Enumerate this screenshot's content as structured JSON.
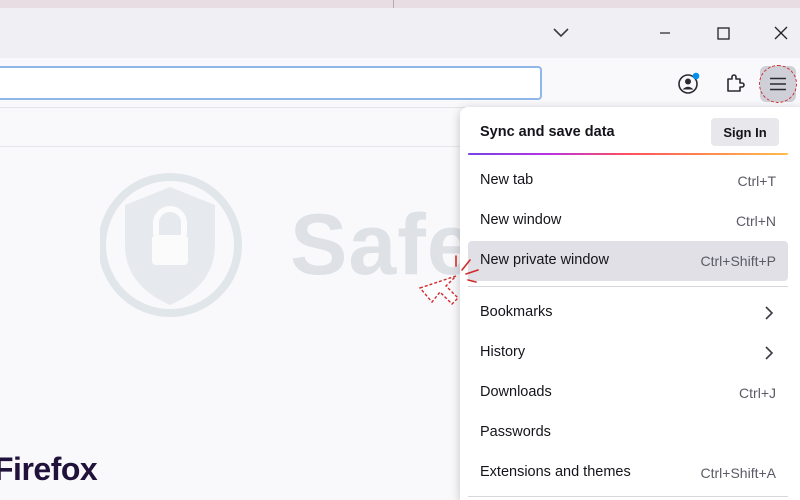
{
  "window": {
    "controls": [
      {
        "name": "list-all-tabs",
        "icon": "chevron-down-icon"
      },
      {
        "name": "minimize",
        "icon": "minimize-icon"
      },
      {
        "name": "maximize",
        "icon": "maximize-icon"
      },
      {
        "name": "close",
        "icon": "close-icon"
      }
    ]
  },
  "toolbar": {
    "url_value": "",
    "icons": [
      "account-icon",
      "extensions-icon",
      "hamburger-menu-icon"
    ]
  },
  "brand": {
    "name": "Firefox"
  },
  "watermark": {
    "text": "Safelyo"
  },
  "app_menu": {
    "sync": {
      "title": "Sync and save data",
      "sign_in_label": "Sign In"
    },
    "items": [
      {
        "label": "New tab",
        "shortcut": "Ctrl+T"
      },
      {
        "label": "New window",
        "shortcut": "Ctrl+N"
      },
      {
        "label": "New private window",
        "shortcut": "Ctrl+Shift+P"
      },
      {
        "label": "Bookmarks",
        "shortcut": ""
      },
      {
        "label": "History",
        "shortcut": ""
      },
      {
        "label": "Downloads",
        "shortcut": "Ctrl+J"
      },
      {
        "label": "Passwords",
        "shortcut": ""
      },
      {
        "label": "Extensions and themes",
        "shortcut": "Ctrl+Shift+A"
      }
    ]
  },
  "colors": {
    "highlight_ring": "#d02a2a",
    "hovered_item_bg": "#e0e0e6",
    "account_badge": "#0090ed"
  }
}
